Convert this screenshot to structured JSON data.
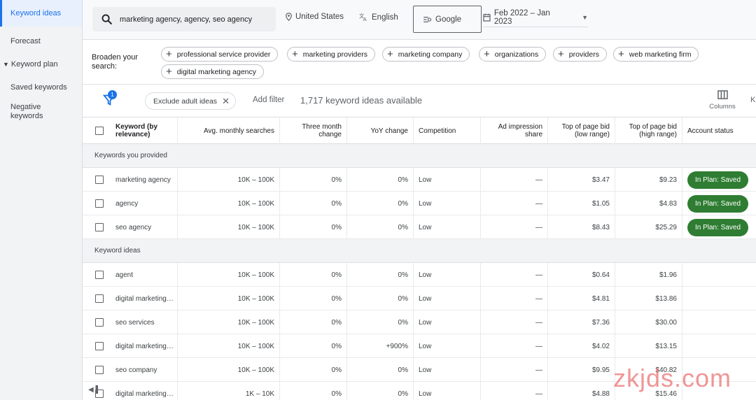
{
  "sidebar": {
    "items": [
      {
        "label": "Keyword ideas"
      },
      {
        "label": "Forecast"
      },
      {
        "label": "Keyword plan"
      },
      {
        "label": "Saved keywords"
      },
      {
        "label": "Negative keywords"
      }
    ]
  },
  "topbar": {
    "search_value": "marketing agency, agency, seo agency",
    "location": "United States",
    "language": "English",
    "network": "Google",
    "date_range": "Feb 2022 – Jan 2023"
  },
  "broaden": {
    "label": "Broaden your search:",
    "chips": [
      "professional service provider",
      "marketing providers",
      "marketing company",
      "organizations",
      "providers",
      "web marketing firm",
      "digital marketing agency"
    ]
  },
  "filters": {
    "badge_count": "1",
    "exclude_chip": "Exclude adult ideas",
    "add_filter": "Add filter",
    "ideas_count": "1,717 keyword ideas available",
    "columns_label": "Columns",
    "truncated_label": "K"
  },
  "table": {
    "headers": {
      "keyword": "Keyword (by relevance)",
      "avg_searches": "Avg. monthly searches",
      "three_month": "Three month change",
      "yoy": "YoY change",
      "competition": "Competition",
      "ad_impression": "Ad impression share",
      "bid_low": "Top of page bid (low range)",
      "bid_high": "Top of page bid (high range)",
      "account_status": "Account status"
    },
    "group_provided": "Keywords you provided",
    "group_ideas": "Keyword ideas",
    "provided_rows": [
      {
        "keyword": "marketing agency",
        "searches": "10K – 100K",
        "three": "0%",
        "yoy": "0%",
        "comp": "Low",
        "ad": "—",
        "low": "$3.47",
        "high": "$9.23",
        "status": "In Plan: Saved"
      },
      {
        "keyword": "agency",
        "searches": "10K – 100K",
        "three": "0%",
        "yoy": "0%",
        "comp": "Low",
        "ad": "—",
        "low": "$1.05",
        "high": "$4.83",
        "status": "In Plan: Saved"
      },
      {
        "keyword": "seo agency",
        "searches": "10K – 100K",
        "three": "0%",
        "yoy": "0%",
        "comp": "Low",
        "ad": "—",
        "low": "$8.43",
        "high": "$25.29",
        "status": "In Plan: Saved"
      }
    ],
    "idea_rows": [
      {
        "keyword": "agent",
        "searches": "10K – 100K",
        "three": "0%",
        "yoy": "0%",
        "comp": "Low",
        "ad": "—",
        "low": "$0.64",
        "high": "$1.96"
      },
      {
        "keyword": "digital marketing…",
        "searches": "10K – 100K",
        "three": "0%",
        "yoy": "0%",
        "comp": "Low",
        "ad": "—",
        "low": "$4.81",
        "high": "$13.86"
      },
      {
        "keyword": "seo services",
        "searches": "10K – 100K",
        "three": "0%",
        "yoy": "0%",
        "comp": "Low",
        "ad": "—",
        "low": "$7.36",
        "high": "$30.00"
      },
      {
        "keyword": "digital marketing…",
        "searches": "10K – 100K",
        "three": "0%",
        "yoy": "+900%",
        "comp": "Low",
        "ad": "—",
        "low": "$4.02",
        "high": "$13.15"
      },
      {
        "keyword": "seo company",
        "searches": "10K – 100K",
        "three": "0%",
        "yoy": "0%",
        "comp": "Low",
        "ad": "—",
        "low": "$9.95",
        "high": "$40.82"
      },
      {
        "keyword": "digital marketing…",
        "searches": "1K – 10K",
        "three": "0%",
        "yoy": "0%",
        "comp": "Low",
        "ad": "—",
        "low": "$4.88",
        "high": "$15.46"
      }
    ]
  },
  "watermark": "zkjds.com",
  "colors": {
    "accent": "#1a73e8",
    "saved_green": "#2e7d32",
    "watermark": "#ea7878"
  }
}
